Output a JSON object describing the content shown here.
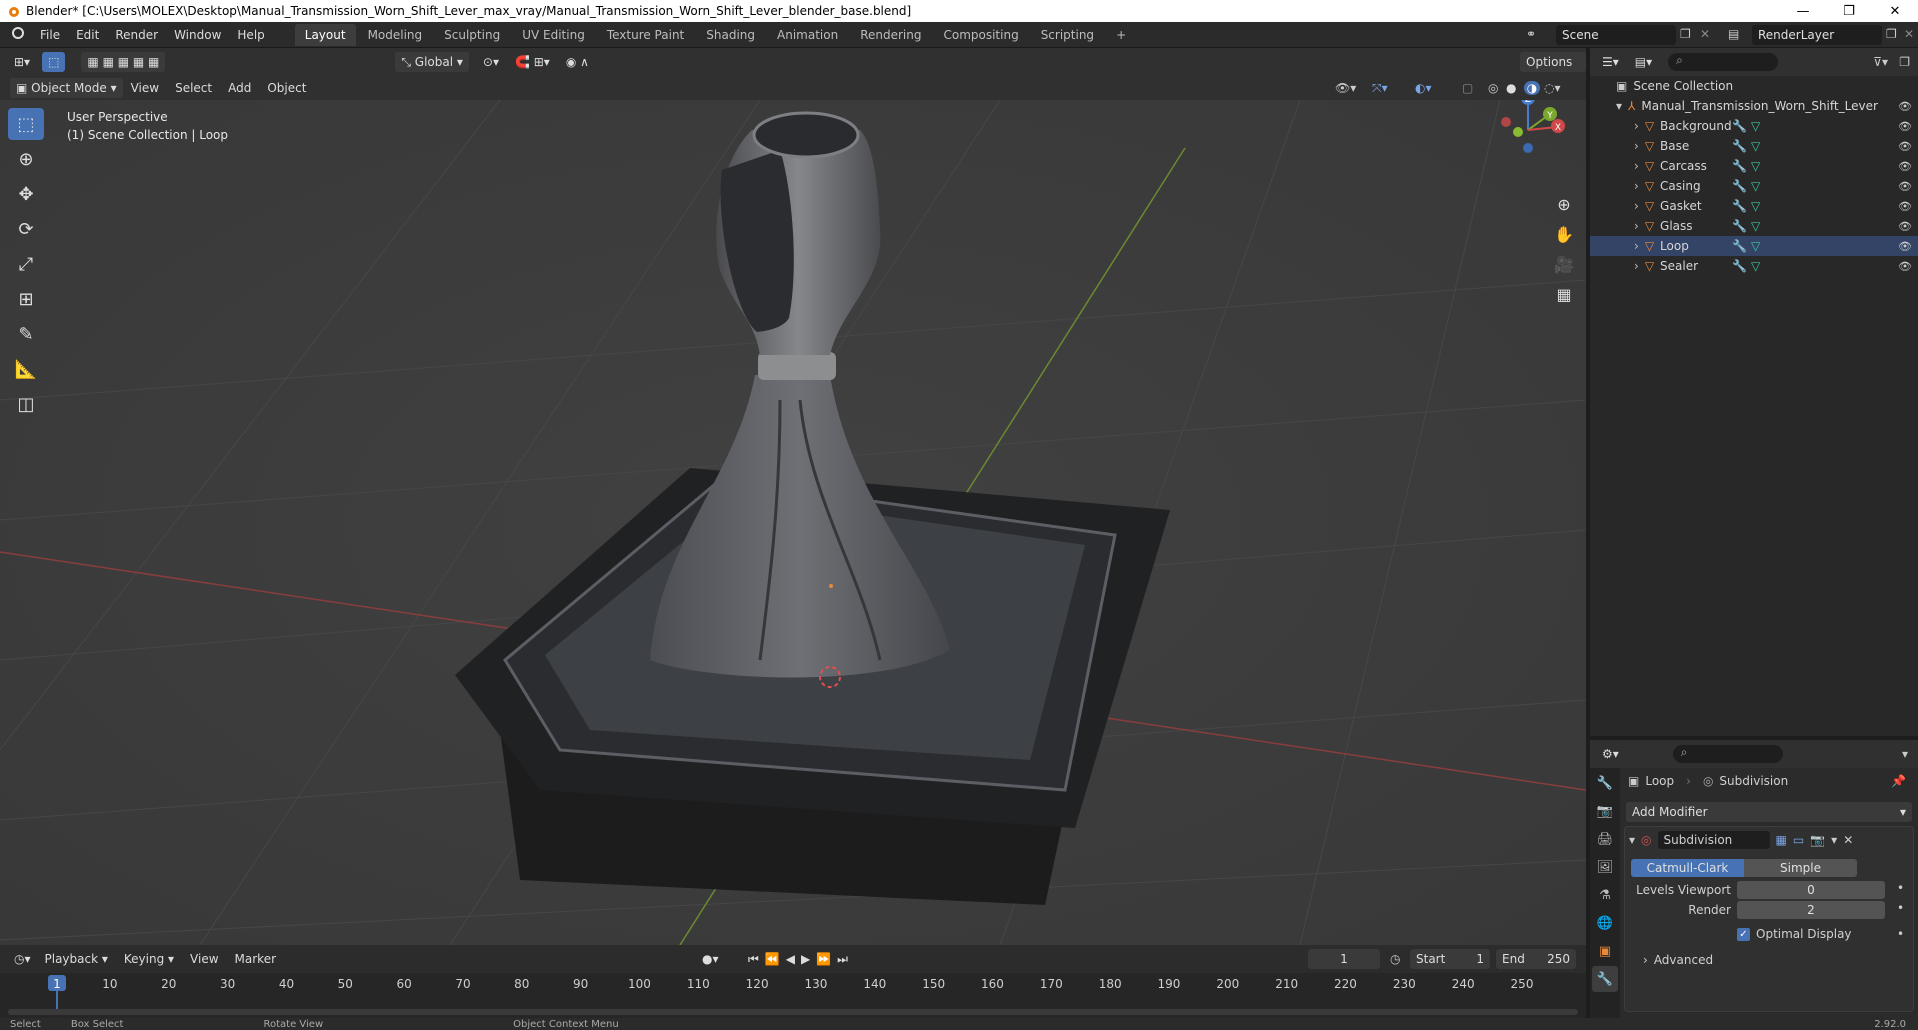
{
  "window": {
    "title": "Blender* [C:\\Users\\MOLEX\\Desktop\\Manual_Transmission_Worn_Shift_Lever_max_vray/Manual_Transmission_Worn_Shift_Lever_blender_base.blend]"
  },
  "menu": [
    "File",
    "Edit",
    "Render",
    "Window",
    "Help"
  ],
  "workspaces": [
    {
      "label": "Layout",
      "active": true
    },
    {
      "label": "Modeling"
    },
    {
      "label": "Sculpting"
    },
    {
      "label": "UV Editing"
    },
    {
      "label": "Texture Paint"
    },
    {
      "label": "Shading"
    },
    {
      "label": "Animation"
    },
    {
      "label": "Rendering"
    },
    {
      "label": "Compositing"
    },
    {
      "label": "Scripting"
    }
  ],
  "scene": {
    "name": "Scene",
    "render_layer": "RenderLayer"
  },
  "viewport_header": {
    "transform": "Global",
    "options": "Options",
    "mode": "Object Mode",
    "menus": [
      "View",
      "Select",
      "Add",
      "Object"
    ]
  },
  "viewport": {
    "perspective": "User Perspective",
    "collection_info": "(1) Scene Collection | Loop"
  },
  "axes": {
    "x": "X",
    "y": "Y",
    "z": "Z"
  },
  "outliner": {
    "root": "Scene Collection",
    "collection": "Manual_Transmission_Worn_Shift_Lever",
    "objects": [
      "Background",
      "Base",
      "Carcass",
      "Casing",
      "Gasket",
      "Glass",
      "Loop",
      "Sealer"
    ]
  },
  "properties": {
    "object_name": "Loop",
    "modifier_label": "Subdivision",
    "add_modifier": "Add Modifier",
    "modifier": {
      "name": "Subdivision",
      "type_options": [
        "Catmull-Clark",
        "Simple"
      ],
      "levels_viewport_label": "Levels Viewport",
      "levels_viewport": "0",
      "render_label": "Render",
      "render": "2",
      "optimal_display": "Optimal Display",
      "advanced": "Advanced"
    }
  },
  "timeline": {
    "menus": [
      "Playback",
      "Keying",
      "View",
      "Marker"
    ],
    "current_frame": "1",
    "start_label": "Start",
    "start": "1",
    "end_label": "End",
    "end": "250",
    "ticks": [
      "1",
      "10",
      "20",
      "30",
      "40",
      "50",
      "60",
      "70",
      "80",
      "90",
      "100",
      "110",
      "120",
      "130",
      "140",
      "150",
      "160",
      "170",
      "180",
      "190",
      "200",
      "210",
      "220",
      "230",
      "240",
      "250"
    ]
  },
  "status": {
    "items": [
      "Select",
      "Box Select",
      "Rotate View",
      "Object Context Menu"
    ],
    "version": "2.92.0"
  },
  "colors": {
    "accent": "#4772b3",
    "orange": "#e8883a",
    "green_axis": "#7aa82c",
    "red_axis": "#a84040"
  }
}
